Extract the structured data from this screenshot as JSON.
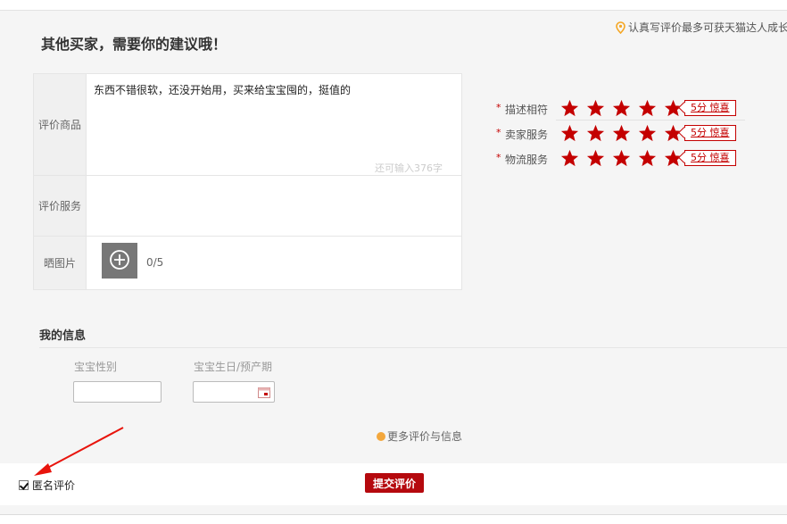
{
  "header": {
    "title": "其他买家，需要你的建议哦！",
    "tip": "认真写评价最多可获天猫达人成长值"
  },
  "review_form": {
    "rows": [
      {
        "label": "评价商品",
        "text": "东西不错很软，还没开始用，买来给宝宝囤的，挺值的",
        "char_count_hint": "还可输入376字"
      },
      {
        "label": "评价服务"
      },
      {
        "label": "晒图片",
        "photo_count": "0/5"
      }
    ]
  },
  "ratings": [
    {
      "required_mark": "*",
      "label": "描述相符",
      "stars": 5,
      "badge": "5分 惊喜"
    },
    {
      "required_mark": "*",
      "label": "卖家服务",
      "stars": 5,
      "badge": "5分 惊喜"
    },
    {
      "required_mark": "*",
      "label": "物流服务",
      "stars": 5,
      "badge": "5分 惊喜"
    }
  ],
  "my_info": {
    "title": "我的信息",
    "gender_label": "宝宝性别",
    "birthday_label": "宝宝生日/预产期",
    "more_link": "更多评价与信息"
  },
  "footer": {
    "anonymous_label": "匿名评价",
    "anonymous_checked": true,
    "submit_label": "提交评价"
  },
  "colors": {
    "accent": "#b5090e",
    "star": "#c40000",
    "dot": "#f3a73c"
  },
  "icons": {
    "tip": "location-pin-icon",
    "upload": "plus-circle-icon",
    "calendar": "calendar-icon"
  }
}
